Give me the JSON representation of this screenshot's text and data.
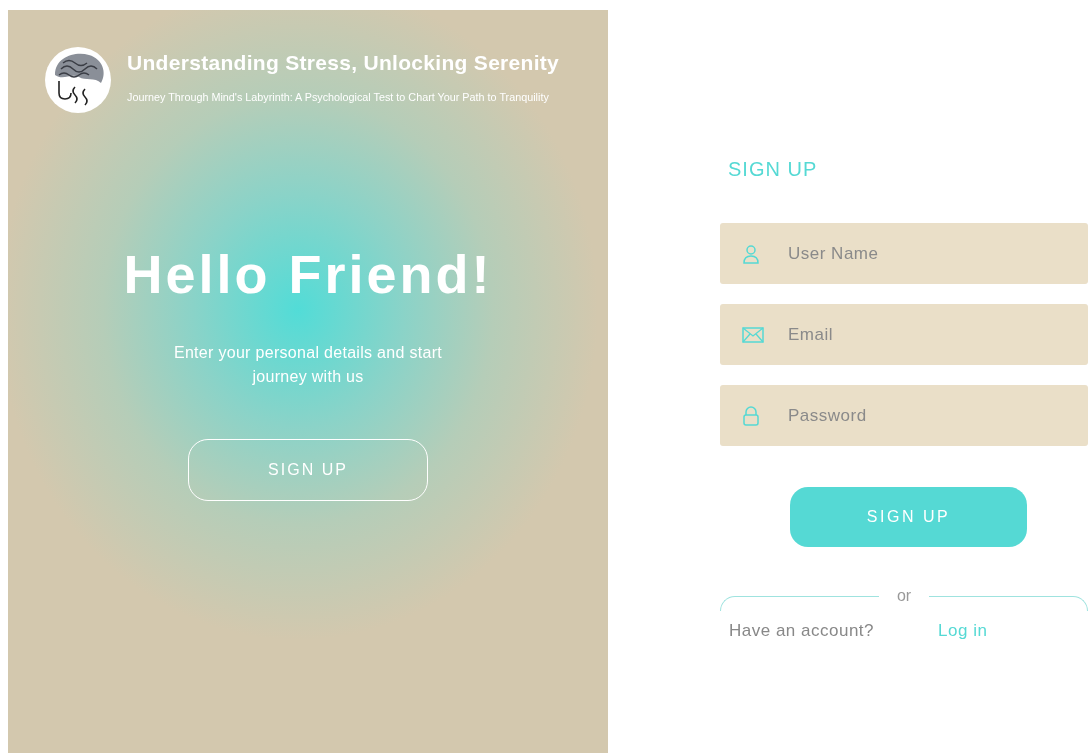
{
  "brand": {
    "title": "Understanding Stress, Unlocking Serenity",
    "tagline": "Journey Through Mind's Labyrinth: A Psychological Test to Chart Your Path to Tranquility"
  },
  "welcome": {
    "heading": "Hello Friend!",
    "text": "Enter your personal details and start journey with us",
    "button": "SIGN UP"
  },
  "form": {
    "title": "SIGN UP",
    "fields": [
      {
        "kind": "user",
        "placeholder": "User Name"
      },
      {
        "kind": "email",
        "placeholder": "Email"
      },
      {
        "kind": "password",
        "placeholder": "Password"
      }
    ],
    "button": "SIGN UP",
    "divider": "or",
    "prompt": "Have an account?",
    "link": "Log in"
  }
}
